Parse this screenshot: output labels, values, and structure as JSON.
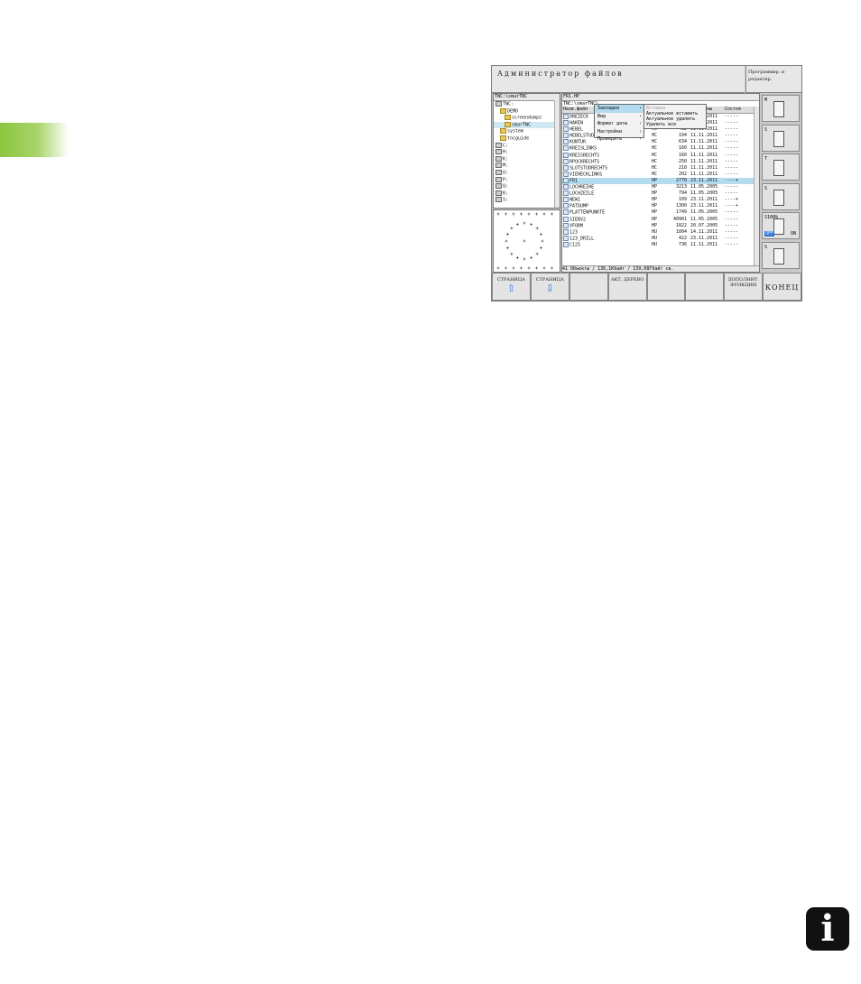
{
  "title": "Администратор файлов",
  "mode_label": "Программир. и редактир.",
  "tree": {
    "path": "TNC:\\smarTNC",
    "items": [
      {
        "label": "TNC:",
        "kind": "drive",
        "indent": 0,
        "selected": false
      },
      {
        "label": "DEMO",
        "kind": "folder",
        "indent": 1,
        "selected": false
      },
      {
        "label": "screendumps",
        "kind": "folder",
        "indent": 2,
        "selected": false
      },
      {
        "label": "smarTNC",
        "kind": "folder",
        "indent": 2,
        "selected": true
      },
      {
        "label": "system",
        "kind": "folder",
        "indent": 1,
        "selected": false
      },
      {
        "label": "tncguide",
        "kind": "folder",
        "indent": 1,
        "selected": false
      },
      {
        "label": "C:",
        "kind": "drive",
        "indent": 0,
        "selected": false
      },
      {
        "label": "H:",
        "kind": "drive",
        "indent": 0,
        "selected": false
      },
      {
        "label": "K:",
        "kind": "drive",
        "indent": 0,
        "selected": false
      },
      {
        "label": "M:",
        "kind": "drive",
        "indent": 0,
        "selected": false
      },
      {
        "label": "O:",
        "kind": "drive",
        "indent": 0,
        "selected": false
      },
      {
        "label": "P:",
        "kind": "drive",
        "indent": 0,
        "selected": false
      },
      {
        "label": "Q:",
        "kind": "drive",
        "indent": 0,
        "selected": false
      },
      {
        "label": "R:",
        "kind": "drive",
        "indent": 0,
        "selected": false
      },
      {
        "label": "S:",
        "kind": "drive",
        "indent": 0,
        "selected": false
      }
    ]
  },
  "files": {
    "header_path": "FR1.HP",
    "sub_path": "TNC:\\smarTNC\\",
    "columns": {
      "name": "Назв.файл",
      "size": "изменены",
      "status": "Состоя"
    },
    "rows": [
      {
        "name": "DREIECK",
        "type": "HC",
        "size": "",
        "date": "14.11.2011",
        "status": "-----",
        "selected": false
      },
      {
        "name": "HAKEN",
        "type": "HC",
        "size": "602",
        "date": "14.11.2011",
        "status": "-----",
        "selected": false
      },
      {
        "name": "HEBEL",
        "type": "HC",
        "size": "432",
        "date": "11.11.2011",
        "status": "-----",
        "selected": false
      },
      {
        "name": "HEBELSTUD",
        "type": "HC",
        "size": "194",
        "date": "11.11.2011",
        "status": "-----",
        "selected": false
      },
      {
        "name": "KONTUR",
        "type": "HC",
        "size": "634",
        "date": "11.11.2011",
        "status": "-----",
        "selected": false
      },
      {
        "name": "KREISLINKS",
        "type": "HC",
        "size": "160",
        "date": "11.11.2011",
        "status": "-----",
        "selected": false
      },
      {
        "name": "KREISRECHTS",
        "type": "HC",
        "size": "160",
        "date": "11.11.2011",
        "status": "-----",
        "selected": false
      },
      {
        "name": "RPOCKRECHTS",
        "type": "HC",
        "size": "250",
        "date": "11.11.2011",
        "status": "-----",
        "selected": false
      },
      {
        "name": "SLOTSTUDRECHTS",
        "type": "HC",
        "size": "210",
        "date": "11.11.2011",
        "status": "-----",
        "selected": false
      },
      {
        "name": "VIERECKLINKS",
        "type": "HC",
        "size": "202",
        "date": "11.11.2011",
        "status": "-----",
        "selected": false
      },
      {
        "name": "FR1",
        "type": "HP",
        "size": "2770",
        "date": "23.11.2011",
        "status": "----+",
        "selected": true
      },
      {
        "name": "LOCHREIHE",
        "type": "HP",
        "size": "3213",
        "date": "11.05.2005",
        "status": "-----",
        "selected": false
      },
      {
        "name": "LOCHZEILE",
        "type": "HP",
        "size": "794",
        "date": "11.05.2005",
        "status": "-----",
        "selected": false
      },
      {
        "name": "NEW1",
        "type": "HP",
        "size": "109",
        "date": "23.11.2011",
        "status": "----+",
        "selected": false
      },
      {
        "name": "PATDUMP",
        "type": "HP",
        "size": "1300",
        "date": "23.11.2011",
        "status": "----+",
        "selected": false
      },
      {
        "name": "PLATTENPUNKTE",
        "type": "HP",
        "size": "1749",
        "date": "11.05.2005",
        "status": "-----",
        "selected": false
      },
      {
        "name": "SIEBV2",
        "type": "HP",
        "size": "40901",
        "date": "11.05.2005",
        "status": "-----",
        "selected": false
      },
      {
        "name": "VFORM",
        "type": "HP",
        "size": "1822",
        "date": "20.07.2005",
        "status": "-----",
        "selected": false
      },
      {
        "name": "123",
        "type": "HU",
        "size": "1004",
        "date": "14.11.2011",
        "status": "-----",
        "selected": false
      },
      {
        "name": "123_DRILL",
        "type": "HU",
        "size": "422",
        "date": "23.11.2011",
        "status": "-----",
        "selected": false
      },
      {
        "name": "C125",
        "type": "HU",
        "size": "736",
        "date": "11.11.2011",
        "status": "-----",
        "selected": false
      }
    ],
    "status_text": "41 Объекты / 136,1Кбайт / 139,08Гбайт св."
  },
  "context_menu": {
    "items": [
      "Закладки",
      "Вид",
      "Формат даты",
      "Настройки",
      "Проверить"
    ],
    "selected_index": 0
  },
  "submenu": {
    "items": [
      "Вставка",
      "Актуальное вставить",
      "Актуальное удалить",
      "Удалить все"
    ],
    "disabled_index": 0
  },
  "side_buttons": [
    {
      "label": "M",
      "icon": "machine-icon"
    },
    {
      "label": "S",
      "icon": "spindle-icon"
    },
    {
      "label": "T",
      "icon": "tool-change-icon"
    },
    {
      "label": "S",
      "icon": "spindle-plus-icon"
    },
    {
      "label": "S100%",
      "icon": "override-icon",
      "off": "OFF",
      "on": "ON"
    },
    {
      "label": "S",
      "icon": "spindle-minus-icon"
    }
  ],
  "softkeys": [
    {
      "label": "СТРАНИЦА",
      "icon": "arrow-up-icon",
      "glyph": "⇧"
    },
    {
      "label": "СТРАНИЦА",
      "icon": "arrow-down-icon",
      "glyph": "⇩"
    },
    {
      "label": "",
      "icon": "",
      "glyph": ""
    },
    {
      "label": "АКТ. ДЕРЕВО",
      "icon": "tree-icon",
      "glyph": ""
    },
    {
      "label": "",
      "icon": "",
      "glyph": ""
    },
    {
      "label": "",
      "icon": "",
      "glyph": ""
    },
    {
      "label": "ДОПОЛНИТ. ФУНКЦИИ",
      "icon": "",
      "glyph": ""
    },
    {
      "label": "КОНЕЦ",
      "icon": "",
      "glyph": ""
    }
  ],
  "info_glyph": "i"
}
